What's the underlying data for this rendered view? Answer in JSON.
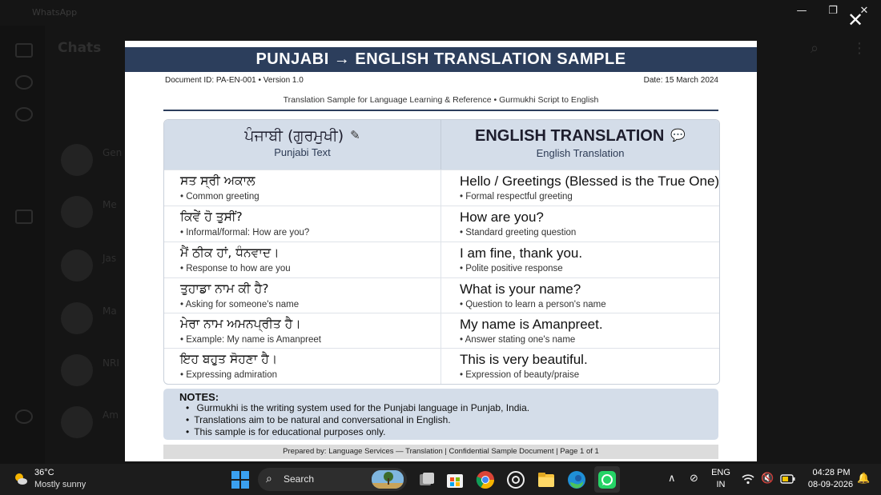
{
  "background_app": {
    "title": "WhatsApp",
    "chats_title": "Chats",
    "chat_names": [
      "Gen",
      "Me",
      "Jas",
      "Ma",
      "NRI",
      "Am"
    ]
  },
  "viewer": {
    "close_glyph": "✕"
  },
  "window_controls": {
    "minimize": "—",
    "restore": "❐",
    "close": "✕"
  },
  "document": {
    "title": "PUNJABI → ENGLISH TRANSLATION SAMPLE",
    "doc_id": "Document ID: PA-EN-001 • Version 1.0",
    "date": "Date: 15 March 2024",
    "subtitle": "Translation Sample for Language Learning & Reference • Gurmukhi Script to English",
    "table": {
      "left_header": "ਪੰਜਾਬੀ (ਗੁਰਮੁਖੀ)",
      "left_subheader": "Punjabi Text",
      "right_header": "ENGLISH TRANSLATION",
      "right_subheader": "English Translation",
      "rows": [
        {
          "pa": "ਸਤ ਸ੍ਰੀ ਅਕਾਲ",
          "pa_note": "• Common greeting",
          "en": "Hello / Greetings (Blessed is the True One)",
          "en_note": "• Formal respectful greeting"
        },
        {
          "pa": "ਕਿਵੇਂ ਹੋ ਤੁਸੀਂ?",
          "pa_note": "• Informal/formal: How are you?",
          "en": "How are you?",
          "en_note": "• Standard greeting question"
        },
        {
          "pa": "ਮੈਂ ਠੀਕ ਹਾਂ, ਧੰਨਵਾਦ।",
          "pa_note": "• Response to how are you",
          "en": "I am fine, thank you.",
          "en_note": "• Polite positive response"
        },
        {
          "pa": "ਤੁਹਾਡਾ ਨਾਮ ਕੀ ਹੈ?",
          "pa_note": "• Asking for someone's name",
          "en": "What is your name?",
          "en_note": "• Question to learn a person's name"
        },
        {
          "pa": "ਮੇਰਾ ਨਾਮ ਅਮਨਪ੍ਰੀਤ ਹੈ।",
          "pa_note": "• Example: My name is Amanpreet",
          "en": "My name is Amanpreet.",
          "en_note": "• Answer stating one's name"
        },
        {
          "pa": "ਇਹ ਬਹੁਤ ਸੋਹਣਾ ਹੈ।",
          "pa_note": "• Expressing admiration",
          "en": "This is very beautiful.",
          "en_note": "• Expression of beauty/praise"
        }
      ]
    },
    "notes": {
      "title": "NOTES:",
      "items": [
        " Gurmukhi is the writing system used for the Punjabi language in Punjab, India.",
        "Translations aim to be natural and conversational in English.",
        "This sample is for educational purposes only."
      ]
    },
    "footer": "Prepared by: Language Services — Translation | Confidential Sample Document | Page 1 of 1"
  },
  "taskbar": {
    "weather_temp": "36°C",
    "weather_desc": "Mostly sunny",
    "search_label": "Search",
    "lang_line1": "ENG",
    "lang_line2": "IN",
    "time": "04:28 PM",
    "date": "08-09-2026"
  },
  "colors": {
    "header_navy": "#2c3e5c",
    "table_header_bg": "#d4dde9",
    "whatsapp_green": "#25d366"
  }
}
